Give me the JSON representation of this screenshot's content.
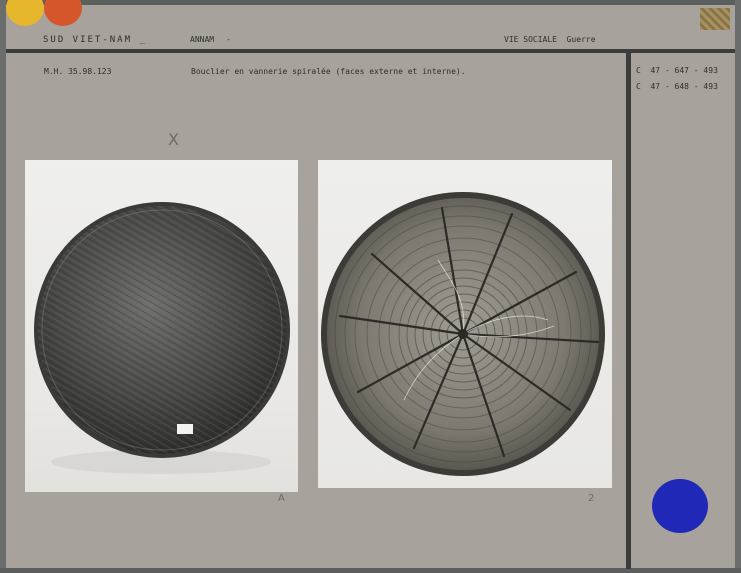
{
  "header": {
    "region": "SUD VIET-NAM _",
    "subregion": "ANNAM",
    "dash": "-",
    "category": "VIE SOCIALE  Guerre"
  },
  "record": {
    "inventory_number": "M.H. 35.98.123",
    "caption": "Bouclier en vannerie spiralée (faces externe et interne)."
  },
  "negatives": [
    "C  47 - 647 - 493",
    "C  47 - 648 - 493"
  ],
  "annotations": {
    "pencil_x": "X",
    "pencil_a": "A",
    "pencil_2": "2"
  },
  "photos": [
    {
      "subject": "shield-external-face"
    },
    {
      "subject": "shield-internal-face"
    }
  ],
  "colors": {
    "card": "#a7a29b",
    "rule": "#3b3c3b",
    "dot_yellow": "#e6b62c",
    "dot_orange": "#d5562a",
    "dot_blue": "#2029b7"
  }
}
